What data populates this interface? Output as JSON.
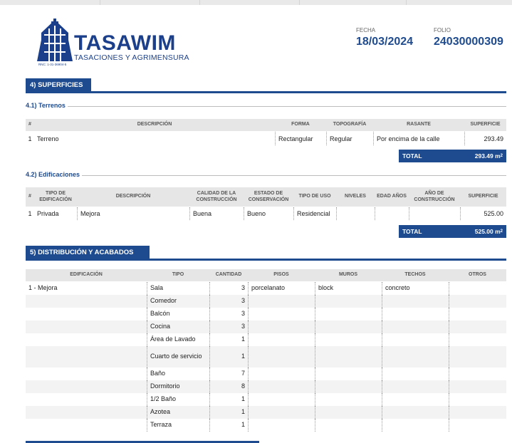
{
  "header": {
    "brand": "TASAWIM",
    "brand_sub": "TASACIONES Y AGRIMENSURA",
    "rnc": "RNC: 1-31-36904-5",
    "fecha_label": "FECHA",
    "fecha_value": "18/03/2024",
    "folio_label": "FOLIO",
    "folio_value": "24030000309",
    "brand_color": "#1e4b8f"
  },
  "section4": {
    "title": "4) SUPERFICIES",
    "terrenos": {
      "title": "4.1) Terrenos",
      "headers": [
        "#",
        "DESCRIPCIÓN",
        "FORMA",
        "TOPOGRAFÍA",
        "RASANTE",
        "SUPERFICIE"
      ],
      "rows": [
        {
          "num": "1",
          "descripcion": "Terreno",
          "forma": "Rectangular",
          "topografia": "Regular",
          "rasante": "Por encima de la calle",
          "superficie": "293.49"
        }
      ],
      "total_label": "TOTAL",
      "total_value": "293.49 m",
      "total_unit": "2"
    },
    "edificaciones": {
      "title": "4.2) Edificaciones",
      "headers": [
        "#",
        "TIPO DE EDIFICACIÓN",
        "DESCRIPCIÓN",
        "CALIDAD DE LA CONSTRUCCIÓN",
        "ESTADO DE CONSERVACIÓN",
        "TIPO DE USO",
        "NIVELES",
        "EDAD AÑOS",
        "AÑO DE CONSTRUCCIÓN",
        "SUPERFICIE"
      ],
      "rows": [
        {
          "num": "1",
          "tipo": "Privada",
          "descripcion": "Mejora",
          "calidad": "Buena",
          "estado": "Bueno",
          "uso": "Residencial",
          "niveles": "",
          "edad": "",
          "anio": "",
          "superficie": "525.00"
        }
      ],
      "total_label": "TOTAL",
      "total_value": "525.00 m",
      "total_unit": "2"
    }
  },
  "section5": {
    "title": "5) DISTRIBUCIÓN Y ACABADOS",
    "headers": [
      "EDIFICACIÓN",
      "TIPO",
      "CANTIDAD",
      "PISOS",
      "MUROS",
      "TECHOS",
      "OTROS"
    ],
    "rows": [
      {
        "edificacion": "1 - Mejora",
        "tipo": "Sala",
        "cantidad": "3",
        "pisos": "porcelanato",
        "muros": "block",
        "techos": "concreto",
        "otros": ""
      },
      {
        "edificacion": "",
        "tipo": "Comedor",
        "cantidad": "3",
        "pisos": "",
        "muros": "",
        "techos": "",
        "otros": ""
      },
      {
        "edificacion": "",
        "tipo": "Balcón",
        "cantidad": "3",
        "pisos": "",
        "muros": "",
        "techos": "",
        "otros": ""
      },
      {
        "edificacion": "",
        "tipo": "Cocina",
        "cantidad": "3",
        "pisos": "",
        "muros": "",
        "techos": "",
        "otros": ""
      },
      {
        "edificacion": "",
        "tipo": "Área de Lavado",
        "cantidad": "1",
        "pisos": "",
        "muros": "",
        "techos": "",
        "otros": ""
      },
      {
        "edificacion": "",
        "tipo": "Cuarto de servicio",
        "cantidad": "1",
        "pisos": "",
        "muros": "",
        "techos": "",
        "otros": ""
      },
      {
        "edificacion": "",
        "tipo": "Baño",
        "cantidad": "7",
        "pisos": "",
        "muros": "",
        "techos": "",
        "otros": ""
      },
      {
        "edificacion": "",
        "tipo": "Dormitorio",
        "cantidad": "8",
        "pisos": "",
        "muros": "",
        "techos": "",
        "otros": ""
      },
      {
        "edificacion": "",
        "tipo": "1/2 Baño",
        "cantidad": "1",
        "pisos": "",
        "muros": "",
        "techos": "",
        "otros": ""
      },
      {
        "edificacion": "",
        "tipo": "Azotea",
        "cantidad": "1",
        "pisos": "",
        "muros": "",
        "techos": "",
        "otros": ""
      },
      {
        "edificacion": "",
        "tipo": "Terraza",
        "cantidad": "1",
        "pisos": "",
        "muros": "",
        "techos": "",
        "otros": ""
      }
    ]
  }
}
